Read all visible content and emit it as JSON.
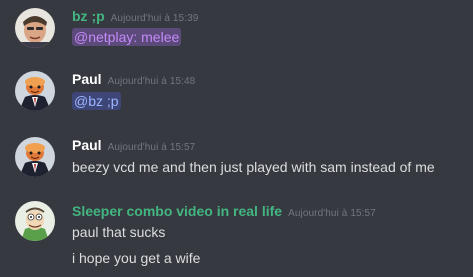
{
  "colors": {
    "background": "#36393f",
    "text": "#dcddde",
    "timestamp": "#72767d",
    "user_green": "#43b581",
    "user_white": "#ffffff",
    "role_mention_text": "#c58af9",
    "role_mention_bg": "#5c4a7a",
    "user_mention_text": "#9cb4ff",
    "user_mention_bg": "#3e4677"
  },
  "messages": [
    {
      "author": "bz ;p",
      "timestamp": "Aujourd'hui à 15:39",
      "avatar_icon": "person-photo-avatar",
      "lines": [
        {
          "mention": "@netplay: melee"
        }
      ]
    },
    {
      "author": "Paul",
      "timestamp": "Aujourd'hui à 15:48",
      "avatar_icon": "suited-character-avatar",
      "lines": [
        {
          "mention": "@bz ;p"
        }
      ]
    },
    {
      "author": "Paul",
      "timestamp": "Aujourd'hui à 15:57",
      "avatar_icon": "suited-character-avatar",
      "lines": [
        {
          "text": "beezy vcd me and then just played with sam instead of me"
        }
      ]
    },
    {
      "author": "Sleeper combo video in real life",
      "timestamp": "Aujourd'hui à 15:57",
      "avatar_icon": "cartoon-character-avatar",
      "lines": [
        {
          "text": "paul that sucks"
        },
        {
          "text": "i hope you get a wife"
        }
      ]
    }
  ]
}
